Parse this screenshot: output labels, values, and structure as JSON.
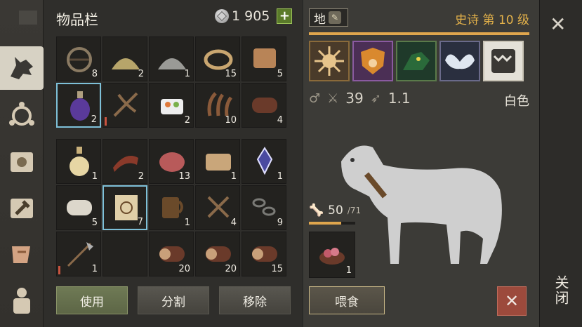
{
  "inventory": {
    "title": "物品栏",
    "currency_amount": "1 905",
    "currency_plus": "+",
    "grid_top": [
      {
        "icon": "bear-trap-icon",
        "qty": "8"
      },
      {
        "icon": "sand-pile-icon",
        "qty": "2"
      },
      {
        "icon": "gravel-pile-icon",
        "qty": "1"
      },
      {
        "icon": "rope-icon",
        "qty": "15"
      },
      {
        "icon": "leather-strips-icon",
        "qty": "5"
      },
      {
        "icon": "potion-bottle-icon",
        "qty": "2",
        "selected": true
      },
      {
        "icon": "crossbow-icon",
        "qty": ""
      },
      {
        "icon": "sushi-food-icon",
        "qty": "2"
      },
      {
        "icon": "tentacle-icon",
        "qty": "10"
      },
      {
        "icon": "leather-roll-icon",
        "qty": "4"
      }
    ],
    "grid_bottom": [
      {
        "icon": "oil-flask-icon",
        "qty": "1"
      },
      {
        "icon": "bacon-icon",
        "qty": "2"
      },
      {
        "icon": "raw-meat-icon",
        "qty": "13"
      },
      {
        "icon": "folded-cloth-icon",
        "qty": "1"
      },
      {
        "icon": "crystal-shard-icon",
        "qty": "1"
      },
      {
        "icon": "paper-roll-icon",
        "qty": "5"
      },
      {
        "icon": "map-scroll-icon",
        "qty": "7",
        "selected": true
      },
      {
        "icon": "wooden-mug-icon",
        "qty": "1"
      },
      {
        "icon": "nails-icon",
        "qty": "4"
      },
      {
        "icon": "chain-icon",
        "qty": "9"
      },
      {
        "icon": "halberd-icon",
        "qty": "1"
      },
      {
        "icon": "empty",
        "qty": ""
      },
      {
        "icon": "log-icon",
        "qty": "20"
      },
      {
        "icon": "log-icon",
        "qty": "20"
      },
      {
        "icon": "log-icon",
        "qty": "15"
      }
    ],
    "btn_use": "使用",
    "btn_split": "分割",
    "btn_remove": "移除"
  },
  "pet": {
    "name": "地",
    "rank": "史诗 第 10 级",
    "attack": "39",
    "speed": "1.1",
    "color": "白色",
    "hunger_current": "50",
    "hunger_max": "/71",
    "hunger_fraction": 0.7,
    "food_qty": "1",
    "btn_feed": "喂食",
    "btn_cancel": "✕"
  },
  "right": {
    "close_x": "✕",
    "close_label": "关闭"
  }
}
